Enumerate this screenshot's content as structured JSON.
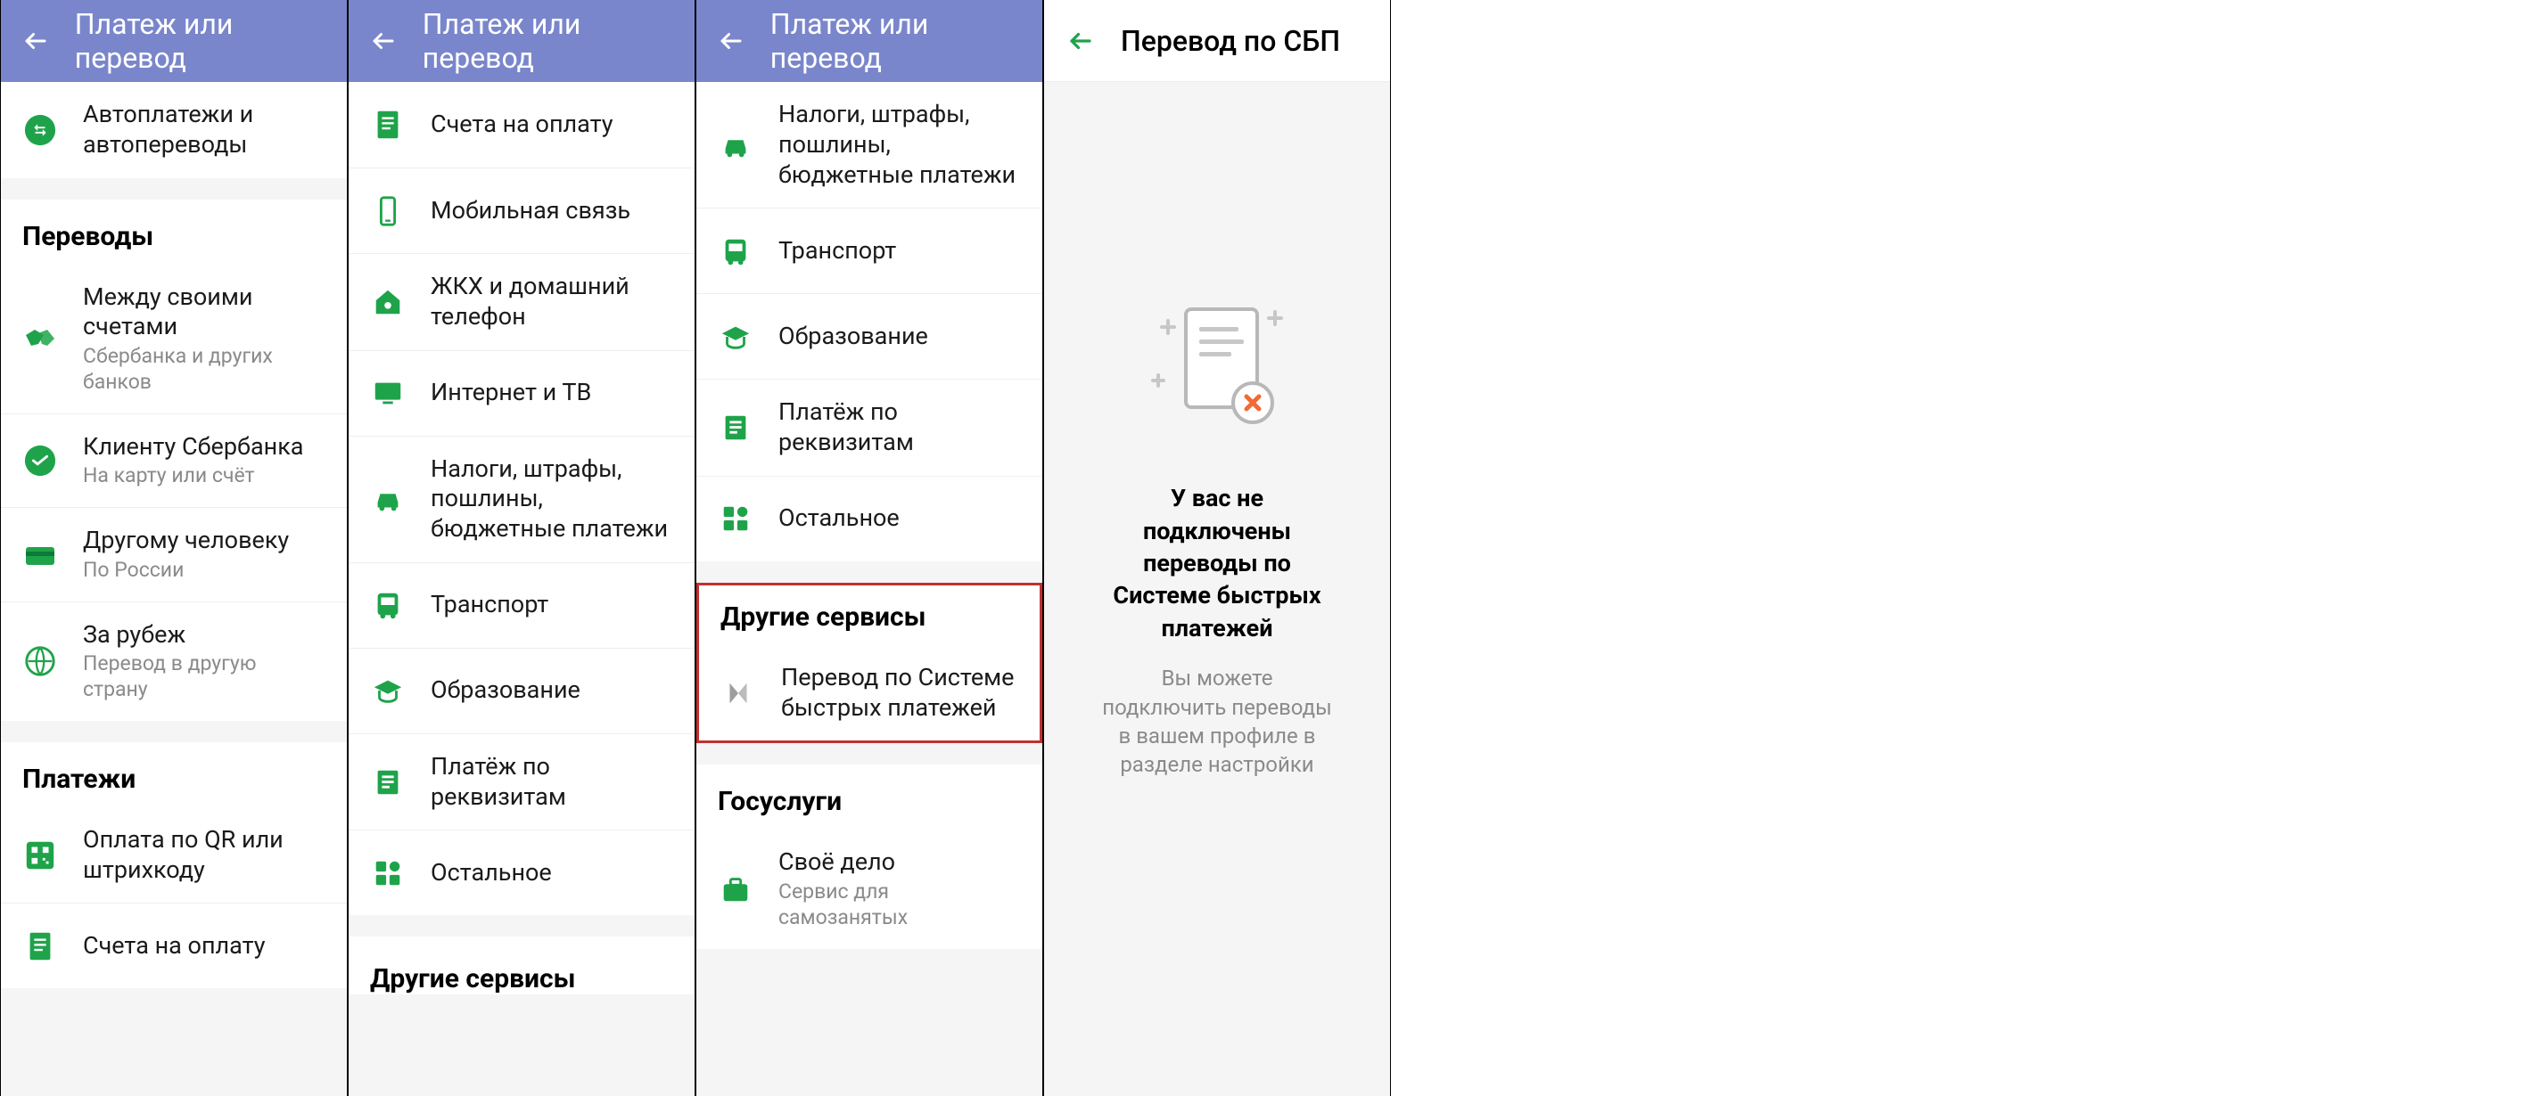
{
  "panel1": {
    "title": "Платеж или перевод",
    "top_item": {
      "title": "Автоплатежи и автопереводы"
    },
    "section_transfers": "Переводы",
    "transfers": [
      {
        "title": "Между своими счетами",
        "sub": "Сбербанка и других банков"
      },
      {
        "title": "Клиенту Сбербанка",
        "sub": "На карту или счёт"
      },
      {
        "title": "Другому человеку",
        "sub": "По России"
      },
      {
        "title": "За рубеж",
        "sub": "Перевод в другую страну"
      }
    ],
    "section_payments": "Платежи",
    "payments": [
      {
        "title": "Оплата по QR или штрихкоду"
      },
      {
        "title": "Счета на оплату"
      }
    ]
  },
  "panel2": {
    "title": "Платеж или перевод",
    "items": [
      {
        "title": "Счета на оплату"
      },
      {
        "title": "Мобильная связь"
      },
      {
        "title": "ЖКХ и домашний телефон"
      },
      {
        "title": "Интернет и ТВ"
      },
      {
        "title": "Налоги, штрафы, пошлины, бюджетные платежи"
      },
      {
        "title": "Транспорт"
      },
      {
        "title": "Образование"
      },
      {
        "title": "Платёж по реквизитам"
      },
      {
        "title": "Остальное"
      }
    ],
    "section_other": "Другие сервисы"
  },
  "panel3": {
    "title": "Платеж или перевод",
    "items_top": [
      {
        "title": "Налоги, штрафы, пошлины, бюджетные платежи"
      },
      {
        "title": "Транспорт"
      },
      {
        "title": "Образование"
      },
      {
        "title": "Платёж по реквизитам"
      },
      {
        "title": "Остальное"
      }
    ],
    "section_other": "Другие сервисы",
    "other_items": [
      {
        "title": "Перевод по Системе быстрых платежей"
      }
    ],
    "section_gos": "Госуслуги",
    "gos_items": [
      {
        "title": "Своё дело",
        "sub": "Сервис для самозанятых"
      }
    ]
  },
  "panel4": {
    "title": "Перевод по СБП",
    "empty_title": "У вас не подключены переводы по Системе быстрых платежей",
    "empty_sub": "Вы можете подключить переводы в вашем профиле в разделе настройки"
  }
}
